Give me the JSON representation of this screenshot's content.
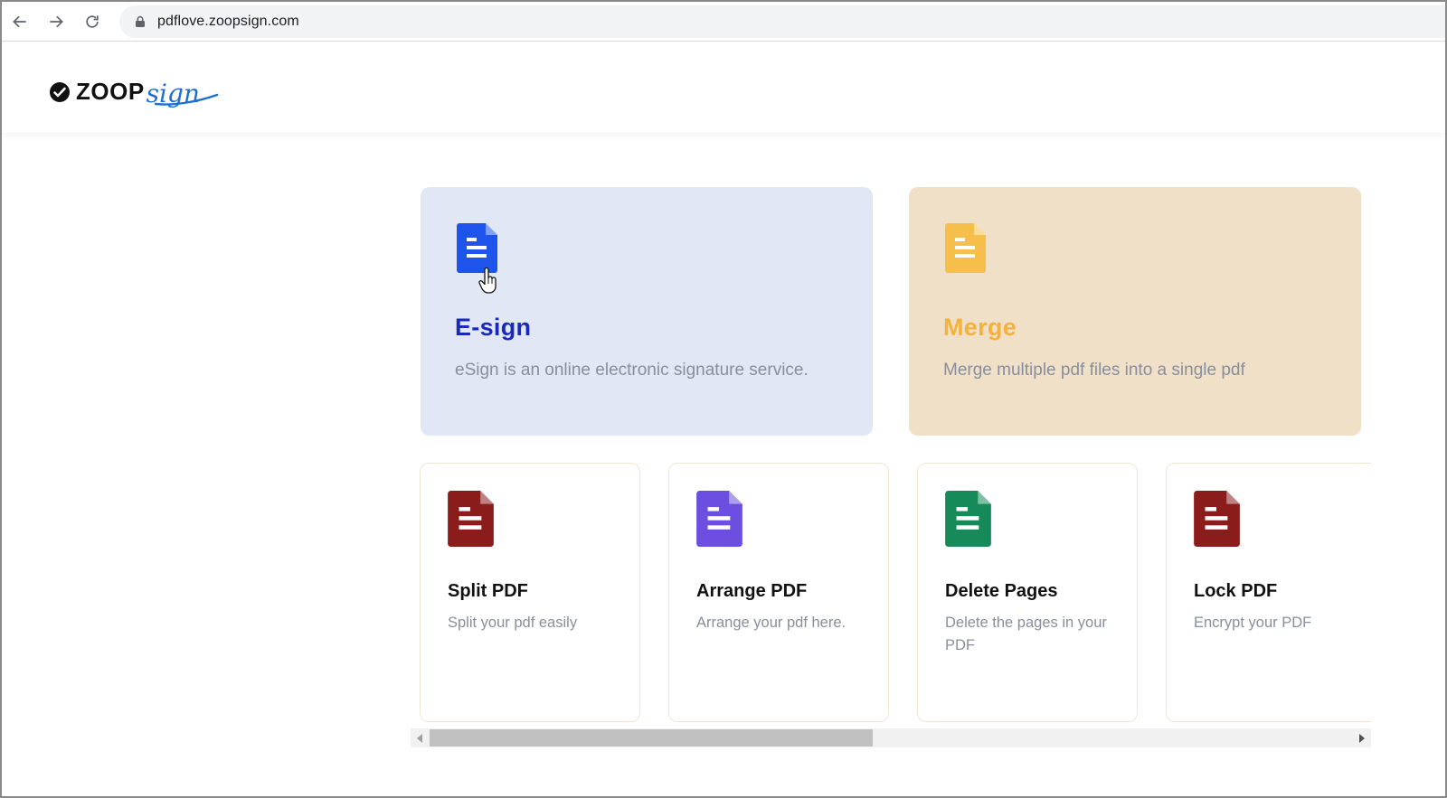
{
  "browser": {
    "url": "pdflove.zoopsign.com",
    "back_icon": "arrow-left-icon",
    "forward_icon": "arrow-right-icon",
    "reload_icon": "reload-icon",
    "lock_icon": "lock-icon"
  },
  "header": {
    "logo_word": "ZOOP",
    "logo_script": "sign",
    "logo_icon": "check-circle-icon"
  },
  "featured": [
    {
      "title": "E-sign",
      "description": "eSign is an online electronic signature service.",
      "icon": "document-icon",
      "icon_color": "#1e54ec",
      "title_color": "#1a2ab8",
      "bg": "#e1e7f5"
    },
    {
      "title": "Merge",
      "description": "Merge multiple pdf files into a single pdf",
      "icon": "document-icon",
      "icon_color": "#f6bf4a",
      "title_color": "#f3b23c",
      "bg": "#efe0c7"
    }
  ],
  "tools": [
    {
      "title": "Split PDF",
      "description": "Split your pdf easily",
      "icon": "document-icon",
      "icon_color": "#8b1c1c"
    },
    {
      "title": "Arrange PDF",
      "description": "Arrange your pdf here.",
      "icon": "document-icon",
      "icon_color": "#6c4fe0"
    },
    {
      "title": "Delete Pages",
      "description": "Delete the pages in your PDF",
      "icon": "document-icon",
      "icon_color": "#168a58"
    },
    {
      "title": "Lock PDF",
      "description": "Encrypt your PDF",
      "icon": "document-icon",
      "icon_color": "#8b1c1c"
    }
  ],
  "scrollbar": {
    "position_fraction": 0.0,
    "visible_fraction": 0.48
  }
}
